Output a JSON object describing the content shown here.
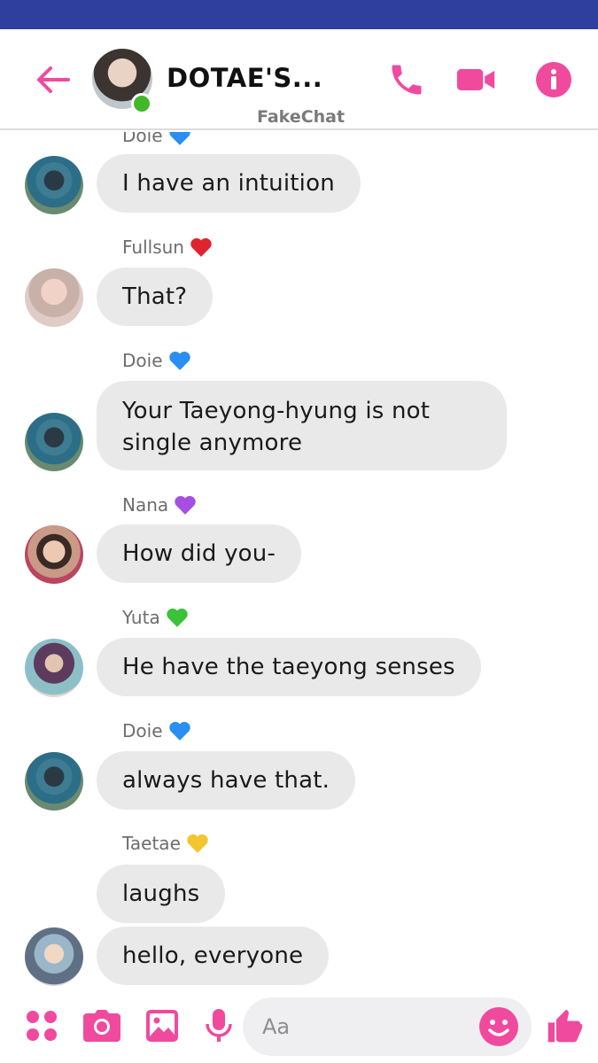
{
  "colors": {
    "status_bar": "#2e3f9e",
    "accent": "#f04a9e",
    "bubble": "#e9e9e9",
    "online": "#42b72a"
  },
  "header": {
    "title": "DOTAE'S...",
    "subtitle": "FakeChat",
    "icons": [
      "back-arrow-icon",
      "phone-icon",
      "video-camera-icon",
      "info-icon"
    ]
  },
  "messages": [
    {
      "sender": "Doie",
      "heart": "blue",
      "text": "I have an intuition",
      "avatar": "doie"
    },
    {
      "sender": "Fullsun",
      "heart": "red",
      "text": "That?",
      "avatar": "fullsun"
    },
    {
      "sender": "Doie",
      "heart": "blue",
      "text": "Your Taeyong-hyung is not single anymore",
      "avatar": "doie"
    },
    {
      "sender": "Nana",
      "heart": "purple",
      "text": "How did you-",
      "avatar": "nana"
    },
    {
      "sender": "Yuta",
      "heart": "green",
      "text": "He have the taeyong senses",
      "avatar": "yuta"
    },
    {
      "sender": "Doie",
      "heart": "blue",
      "text": "always have that.",
      "avatar": "doie"
    },
    {
      "sender": "Taetae",
      "heart": "yellow",
      "text": "laughs",
      "avatar": ""
    },
    {
      "sender": "",
      "heart": "",
      "text": "hello, everyone",
      "avatar": "taetae"
    }
  ],
  "partial_top_sender": "Doie",
  "composer": {
    "placeholder": "Aa",
    "icons": [
      "apps-grid-icon",
      "camera-icon",
      "image-icon",
      "microphone-icon",
      "emoji-icon",
      "thumbs-up-icon"
    ]
  }
}
